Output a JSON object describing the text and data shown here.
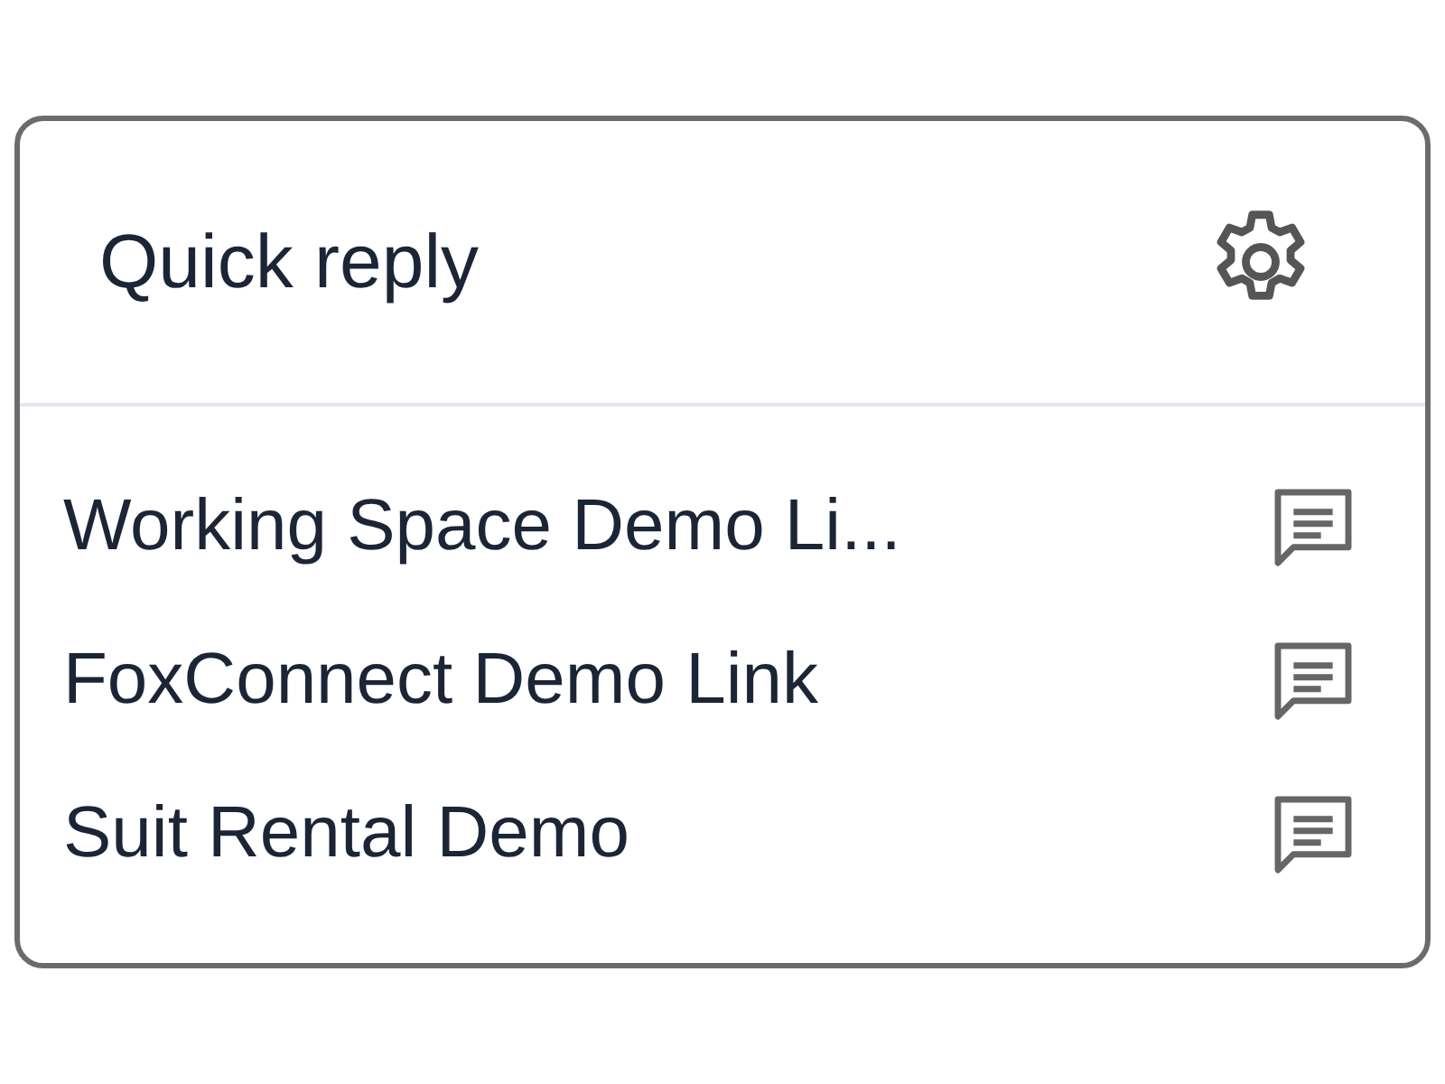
{
  "header": {
    "title": "Quick reply"
  },
  "items": [
    {
      "label": "Working Space Demo Li..."
    },
    {
      "label": "FoxConnect Demo Link"
    },
    {
      "label": "Suit Rental Demo"
    }
  ]
}
